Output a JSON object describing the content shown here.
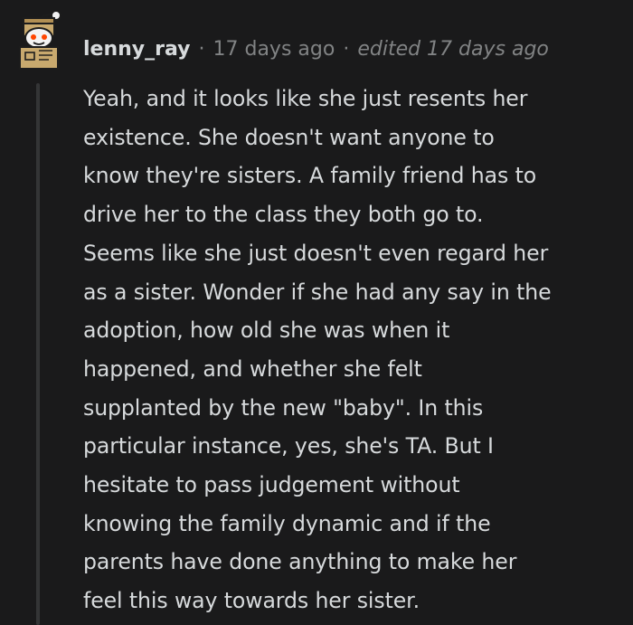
{
  "comment": {
    "author": "lenny_ray",
    "separator": "·",
    "time": "17 days ago",
    "edited": "edited 17 days ago",
    "avatar_icon": "snoo-robot-box-avatar",
    "body_lines": [
      "Yeah, and it looks like she just resents her",
      "existence. She doesn't want anyone to",
      "know they're sisters. A family friend has to",
      "drive her to the class they both go to.",
      "Seems like she just doesn't even regard her",
      "as a sister. Wonder if she had any say in the",
      "adoption, how old she was when it",
      "happened, and whether she felt",
      "supplanted by the new \"baby\". In this",
      "particular instance, yes, she's TA. But I",
      "hesitate to pass judgement without",
      "knowing the family dynamic and if the",
      "parents have done anything to make her",
      "feel this way towards her sister."
    ]
  },
  "colors": {
    "background": "#1a1a1b",
    "text": "#d7dadc",
    "meta": "#818384",
    "thread_line": "#343536",
    "avatar_box": "#c8a96e",
    "avatar_eye": "#ff4500"
  }
}
